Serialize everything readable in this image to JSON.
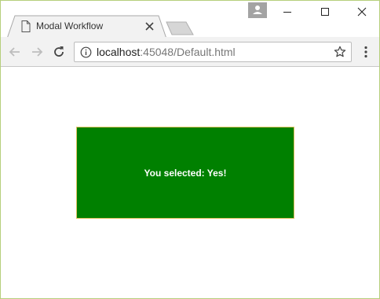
{
  "browser": {
    "tab": {
      "title": "Modal Workflow",
      "page_icon": "page-icon",
      "close_icon": "close-icon"
    },
    "address_bar": {
      "host": "localhost",
      "rest": ":45048/Default.html"
    },
    "icons": {
      "back": "arrow-left-icon",
      "forward": "arrow-right-icon",
      "reload": "reload-icon",
      "info": "info-icon",
      "bookmark": "star-icon",
      "menu": "kebab-menu-icon",
      "profile": "profile-icon"
    }
  },
  "page": {
    "result_message": "You selected: Yes!"
  },
  "colors": {
    "result_background": "#008000",
    "result_text": "#ffffff",
    "frame_border": "#b6cf7c"
  }
}
